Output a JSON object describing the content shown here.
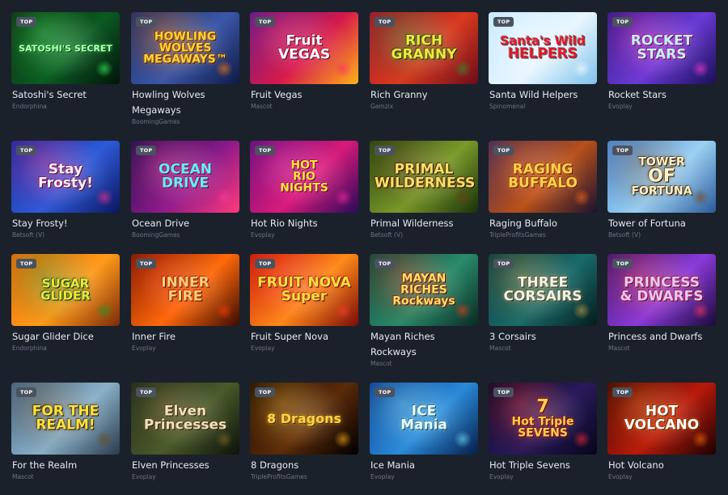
{
  "badge_label": "TOP",
  "games": [
    {
      "title": "Satoshi's Secret",
      "provider": "Endorphina",
      "art_lines": [
        "SATOSHI'S SECRET"
      ],
      "icon": "bitcoin-hacker-icon",
      "bg": [
        "#0d2a10",
        "#0b5a22",
        "#02140a"
      ],
      "art_color": "#b6ffb9",
      "glow": "#38ff5a"
    },
    {
      "title": "Howling Wolves Megaways",
      "provider": "BoomingGames",
      "art_lines": [
        "HOWLING",
        "WOLVES",
        "MEGAWAYS™"
      ],
      "icon": "wolf-icon",
      "bg": [
        "#1c2b66",
        "#3a57a8",
        "#101a45"
      ],
      "art_color": "#ffd23a",
      "glow": "#ff7b00"
    },
    {
      "title": "Fruit Vegas",
      "provider": "Mascot",
      "art_lines": [
        "Fruit",
        "VEGAS"
      ],
      "icon": "fruit-icon",
      "bg": [
        "#5a1c8a",
        "#d61a4a",
        "#ffb21a"
      ],
      "art_color": "#ffffff",
      "glow": "#ff2d6a"
    },
    {
      "title": "Rich Granny",
      "provider": "Gamzix",
      "art_lines": [
        "RICH",
        "GRANNY"
      ],
      "icon": "granny-icon",
      "bg": [
        "#a3132e",
        "#d83a1f",
        "#6a0c1b"
      ],
      "art_color": "#ffe43a",
      "glow": "#2b9a2b"
    },
    {
      "title": "Santa Wild Helpers",
      "provider": "Spinomenal",
      "art_lines": [
        "Santa's Wild",
        "HELPERS"
      ],
      "icon": "reindeer-icon",
      "bg": [
        "#bfe7ff",
        "#e9f6ff",
        "#7fc2ea"
      ],
      "art_color": "#e0162b",
      "glow": "#ffffff"
    },
    {
      "title": "Rocket Stars",
      "provider": "Evoplay",
      "art_lines": [
        "ROCKET",
        "STARS"
      ],
      "icon": "rocket-icon",
      "bg": [
        "#2a1a7a",
        "#6a3ad6",
        "#1a0f55"
      ],
      "art_color": "#bff3ff",
      "glow": "#ff3ad6"
    },
    {
      "title": "Stay Frosty!",
      "provider": "Betsoft (V)",
      "art_lines": [
        "Stay",
        "Frosty!"
      ],
      "icon": "snowflake-icon",
      "bg": [
        "#1a2c9a",
        "#2e5ad8",
        "#0c1660"
      ],
      "art_color": "#e8f6ff",
      "glow": "#ff2a8a"
    },
    {
      "title": "Ocean Drive",
      "provider": "BoomingGames",
      "art_lines": [
        "OCEAN",
        "DRIVE"
      ],
      "icon": "palm-icon",
      "bg": [
        "#1a0f4a",
        "#8a1a8a",
        "#ff3a7a"
      ],
      "art_color": "#5ff0ff",
      "glow": "#ff3a9a"
    },
    {
      "title": "Hot Rio Nights",
      "provider": "Evoplay",
      "art_lines": [
        "HOT",
        "RIO",
        "NIGHTS"
      ],
      "icon": "dancer-icon",
      "bg": [
        "#5a0f7a",
        "#d81a7a",
        "#2a0a5a"
      ],
      "art_color": "#ffe23a",
      "glow": "#ff2aa0"
    },
    {
      "title": "Primal Wilderness",
      "provider": "Betsoft (V)",
      "art_lines": [
        "PRIMAL",
        "WILDERNESS"
      ],
      "icon": "bear-icon",
      "bg": [
        "#2a4a12",
        "#7a9a2a",
        "#18300a"
      ],
      "art_color": "#ffe066",
      "glow": "#6a3a10"
    },
    {
      "title": "Raging Buffalo",
      "provider": "TripleProfitsGames",
      "art_lines": [
        "RAGING",
        "BUFFALO"
      ],
      "icon": "buffalo-icon",
      "bg": [
        "#3a2a5a",
        "#b8501a",
        "#1a1230"
      ],
      "art_color": "#ffd24a",
      "glow": "#ff6a1a"
    },
    {
      "title": "Tower of Fortuna",
      "provider": "Betsoft (V)",
      "art_lines": [
        "TOWER",
        "OF",
        "FORTUNA"
      ],
      "icon": "tower-icon",
      "bg": [
        "#4a8ad8",
        "#9ad0f2",
        "#2a5a9a"
      ],
      "art_color": "#fff3c8",
      "glow": "#7a4a1a"
    },
    {
      "title": "Sugar Glider Dice",
      "provider": "Endorphina",
      "art_lines": [
        "SUGAR GLIDER"
      ],
      "icon": "glider-icon",
      "bg": [
        "#e86a0a",
        "#ff9a1a",
        "#7a2a0a"
      ],
      "art_color": "#ffe23a",
      "glow": "#1a9a2a"
    },
    {
      "title": "Inner Fire",
      "provider": "Evoplay",
      "art_lines": [
        "INNER",
        "FIRE"
      ],
      "icon": "flame-icon",
      "bg": [
        "#7a1a05",
        "#ff6a0a",
        "#3a0a02"
      ],
      "art_color": "#ffd07a",
      "glow": "#ff3a0a"
    },
    {
      "title": "Fruit Super Nova",
      "provider": "Evoplay",
      "art_lines": [
        "FRUIT NOVA",
        "Super"
      ],
      "icon": "fruit-icon",
      "bg": [
        "#c81a0a",
        "#ff8a1a",
        "#7a0a0a"
      ],
      "art_color": "#ffe23a",
      "glow": "#ff3a2a"
    },
    {
      "title": "Mayan Riches Rockways",
      "provider": "Mascot",
      "art_lines": [
        "MAYAN",
        "RICHES",
        "Rockways"
      ],
      "icon": "temple-icon",
      "bg": [
        "#0f4a3a",
        "#2a8a6a",
        "#0a2a22"
      ],
      "art_color": "#ffe066",
      "glow": "#e83a1a"
    },
    {
      "title": "3 Corsairs",
      "provider": "Mascot",
      "art_lines": [
        "THREE",
        "CORSAIRS"
      ],
      "icon": "swords-icon",
      "bg": [
        "#0a3a3a",
        "#1a6a6a",
        "#041c1c"
      ],
      "art_color": "#e8f4f4",
      "glow": "#c8a24a"
    },
    {
      "title": "Princess and Dwarfs",
      "provider": "Mascot",
      "art_lines": [
        "PRINCESS",
        "& DWARFS"
      ],
      "icon": "princess-icon",
      "bg": [
        "#3a1a6a",
        "#8a3ad8",
        "#1a0a3a"
      ],
      "art_color": "#e8c8ff",
      "glow": "#ff3a5a"
    },
    {
      "title": "For the Realm",
      "provider": "Mascot",
      "art_lines": [
        "FOR THE",
        "REALM!"
      ],
      "icon": "knight-icon",
      "bg": [
        "#4a6a8a",
        "#8ab0c8",
        "#2a3a4a"
      ],
      "art_color": "#ffe23a",
      "glow": "#6a4a1a"
    },
    {
      "title": "Elven Princesses",
      "provider": "Evoplay",
      "art_lines": [
        "Elven",
        "Princesses"
      ],
      "icon": "elf-icon",
      "bg": [
        "#1a2a1a",
        "#4a5a2a",
        "#0a120a"
      ],
      "art_color": "#f0e0c0",
      "glow": "#8a6a2a"
    },
    {
      "title": "8 Dragons",
      "provider": "TripleProfitsGames",
      "art_lines": [
        "8 Dragons"
      ],
      "icon": "dragon-icon",
      "bg": [
        "#1a0a05",
        "#5a2a08",
        "#000000"
      ],
      "art_color": "#ffd24a",
      "glow": "#ffb21a"
    },
    {
      "title": "Ice Mania",
      "provider": "Evoplay",
      "art_lines": [
        "ICE",
        "Mania"
      ],
      "icon": "ice-icon",
      "bg": [
        "#0a3a8a",
        "#2a8ad8",
        "#061e4a"
      ],
      "art_color": "#e8fbff",
      "glow": "#7ae0ff"
    },
    {
      "title": "Hot Triple Sevens",
      "provider": "Evoplay",
      "art_lines": [
        "7",
        "Hot Triple",
        "SEVENS"
      ],
      "icon": "seven-icon",
      "bg": [
        "#0a0a2a",
        "#2a1a5a",
        "#05051a"
      ],
      "art_color": "#ffd24a",
      "glow": "#ff2a2a"
    },
    {
      "title": "Hot Volcano",
      "provider": "Evoplay",
      "art_lines": [
        "HOT",
        "VOLCANO"
      ],
      "icon": "volcano-icon",
      "bg": [
        "#3a0505",
        "#b81a0a",
        "#1a0202"
      ],
      "art_color": "#ffffff",
      "glow": "#ff6a0a"
    }
  ]
}
